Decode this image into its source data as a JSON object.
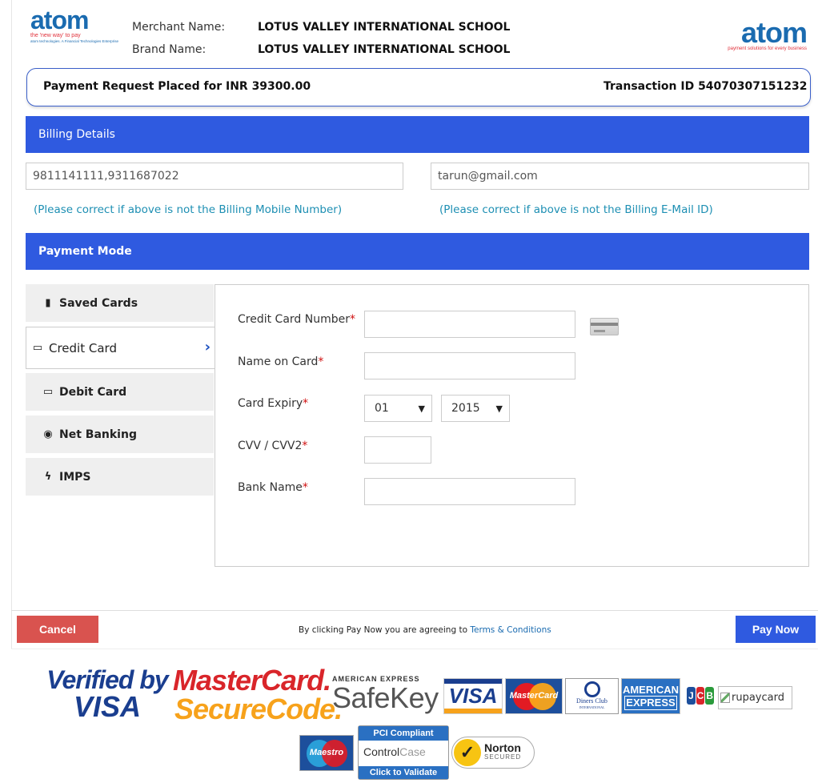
{
  "header": {
    "logo_small_text": "atom",
    "logo_small_tagline": "the 'new way' to pay",
    "logo_small_enterprise": "atom technologies. A Financial Technologies Enterprise",
    "logo_right_text": "atom",
    "logo_right_tagline": "payment solutions for every business",
    "merchant_label": "Merchant Name:",
    "merchant_value": "LOTUS VALLEY INTERNATIONAL SCHOOL",
    "brand_label": "Brand Name:",
    "brand_value": "LOTUS VALLEY INTERNATIONAL SCHOOL"
  },
  "request": {
    "text": "Payment Request Placed for INR  39300.00",
    "transaction": "Transaction ID  54070307151232"
  },
  "billing": {
    "title": "Billing Details",
    "mobile_value": "9811141111,9311687022",
    "email_value": "tarun@gmail.com",
    "mobile_hint": "(Please correct if above is not the Billing Mobile Number)",
    "email_hint": "(Please correct if above is not the Billing E-Mail ID)"
  },
  "payment_mode": {
    "title": "Payment Mode",
    "tabs": [
      {
        "label": "Saved Cards",
        "icon": "bookmark-icon",
        "glyph": "▮"
      },
      {
        "label": "Credit Card",
        "icon": "credit-card-icon",
        "glyph": "▭",
        "active": true
      },
      {
        "label": "Debit Card",
        "icon": "credit-card-icon",
        "glyph": "▭"
      },
      {
        "label": "Net Banking",
        "icon": "globe-icon",
        "glyph": "◉"
      },
      {
        "label": "IMPS",
        "icon": "bolt-icon",
        "glyph": "ϟ"
      }
    ],
    "active_chevron": "›"
  },
  "form": {
    "card_number_label": "Credit Card Number",
    "name_label": "Name on Card",
    "expiry_label": "Card Expiry",
    "cvv_label": "CVV / CVV2",
    "bank_label": "Bank Name",
    "required_mark": "*",
    "expiry_month": "01",
    "expiry_year": "2015",
    "select_arrow": "▼"
  },
  "footer": {
    "cancel_label": "Cancel",
    "pay_label": "Pay Now",
    "agree_text": "By clicking Pay Now you are agreeing to ",
    "terms_link": "Terms & Conditions"
  },
  "badges": {
    "vbv_line1": "Verified by",
    "vbv_line2": "VISA",
    "mc_line1": "MasterCard.",
    "mc_line2": "SecureCode.",
    "safekey_line1": "AMERICAN EXPRESS",
    "safekey_line2": "SafeKey",
    "visa": "VISA",
    "mastercard": "MasterCard",
    "diners_line1": "Diners Club",
    "diners_line2": "INTERNATIONAL",
    "amex_line1": "AMERICAN",
    "amex_line2": "EXPRESS",
    "jcb": [
      "J",
      "C",
      "B"
    ],
    "rupay_alt": "rupaycard",
    "maestro": "Maestro",
    "pci_top": "PCI Compliant",
    "pci_mid_a": "Control",
    "pci_mid_b": "Case",
    "pci_bottom": "Click to Validate",
    "norton_a": "Norton",
    "norton_b": "SECURED",
    "norton_check": "✓"
  },
  "colors": {
    "primary_blue": "#2f5ae0",
    "cancel_red": "#d9534f",
    "hint_teal": "#1d8fb3",
    "required_red": "#d01010"
  }
}
